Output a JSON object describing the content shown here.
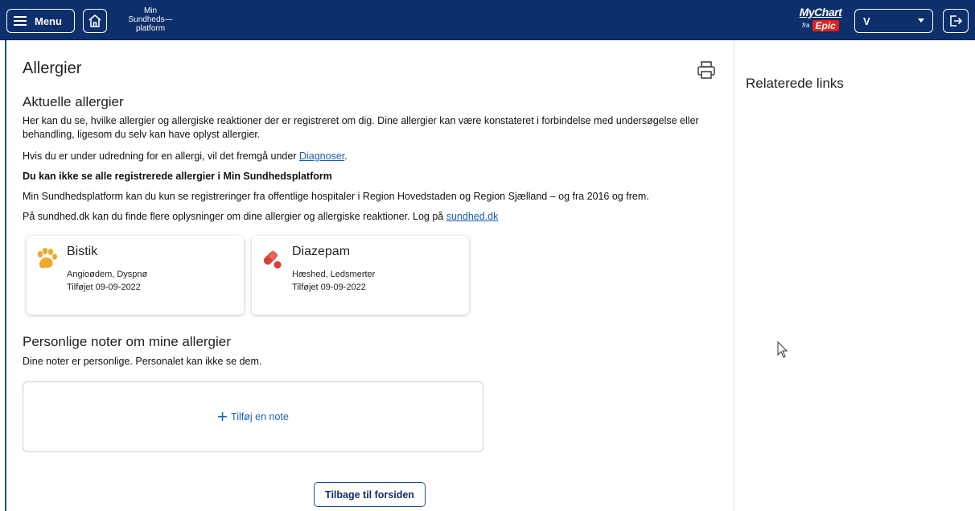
{
  "header": {
    "menu_label": "Menu",
    "brand_line1": "Min",
    "brand_line2": "Sundheds—",
    "brand_line3": "platform",
    "mychart": "MyChart",
    "mychart_fra": "fra",
    "mychart_epic": "Epic",
    "user_selected": "V",
    "bg_color": "#0d2f6b"
  },
  "page": {
    "title": "Allergier",
    "section1_title": "Aktuelle allergier",
    "intro": "Her kan du se, hvilke allergier og allergiske reaktioner der er registreret om dig. Dine allergier kan være konstateret i forbindelse med undersøgelse eller behandling, ligesom du selv kan have oplyst allergier.",
    "diag_prefix": "Hvis du er under udredning for en allergi, vil det fremgå under ",
    "diag_link": "Diagnoser",
    "diag_suffix": ".",
    "warning_bold": "Du kan ikke se alle registrerede allergier i Min Sundhedsplatform",
    "scope_text": "Min Sundhedsplatform kan du kun se registreringer fra offentlige hospitaler i Region Hovedstaden og Region Sjælland – og fra 2016 og frem.",
    "sundhed_prefix": "På sundhed.dk kan du finde flere oplysninger om dine allergier og allergiske reaktioner. Log på ",
    "sundhed_link": "sundhed.dk",
    "allergies": [
      {
        "name": "Bistik",
        "reactions": "Angioødem, Dyspnø",
        "added": "Tilføjet 09-09-2022",
        "icon": "paw-icon",
        "icon_color": "#f0a830"
      },
      {
        "name": "Diazepam",
        "reactions": "Hæshed, Ledsmerter",
        "added": "Tilføjet 09-09-2022",
        "icon": "pill-icon",
        "icon_color": "#d9403a"
      }
    ],
    "section2_title": "Personlige noter om mine allergier",
    "notes_text": "Dine noter er personlige. Personalet kan ikke se dem.",
    "add_note_plus": "+",
    "add_note_label": "Tilføj en note",
    "back_button": "Tilbage til forsiden"
  },
  "sidebar": {
    "title": "Relaterede links"
  }
}
